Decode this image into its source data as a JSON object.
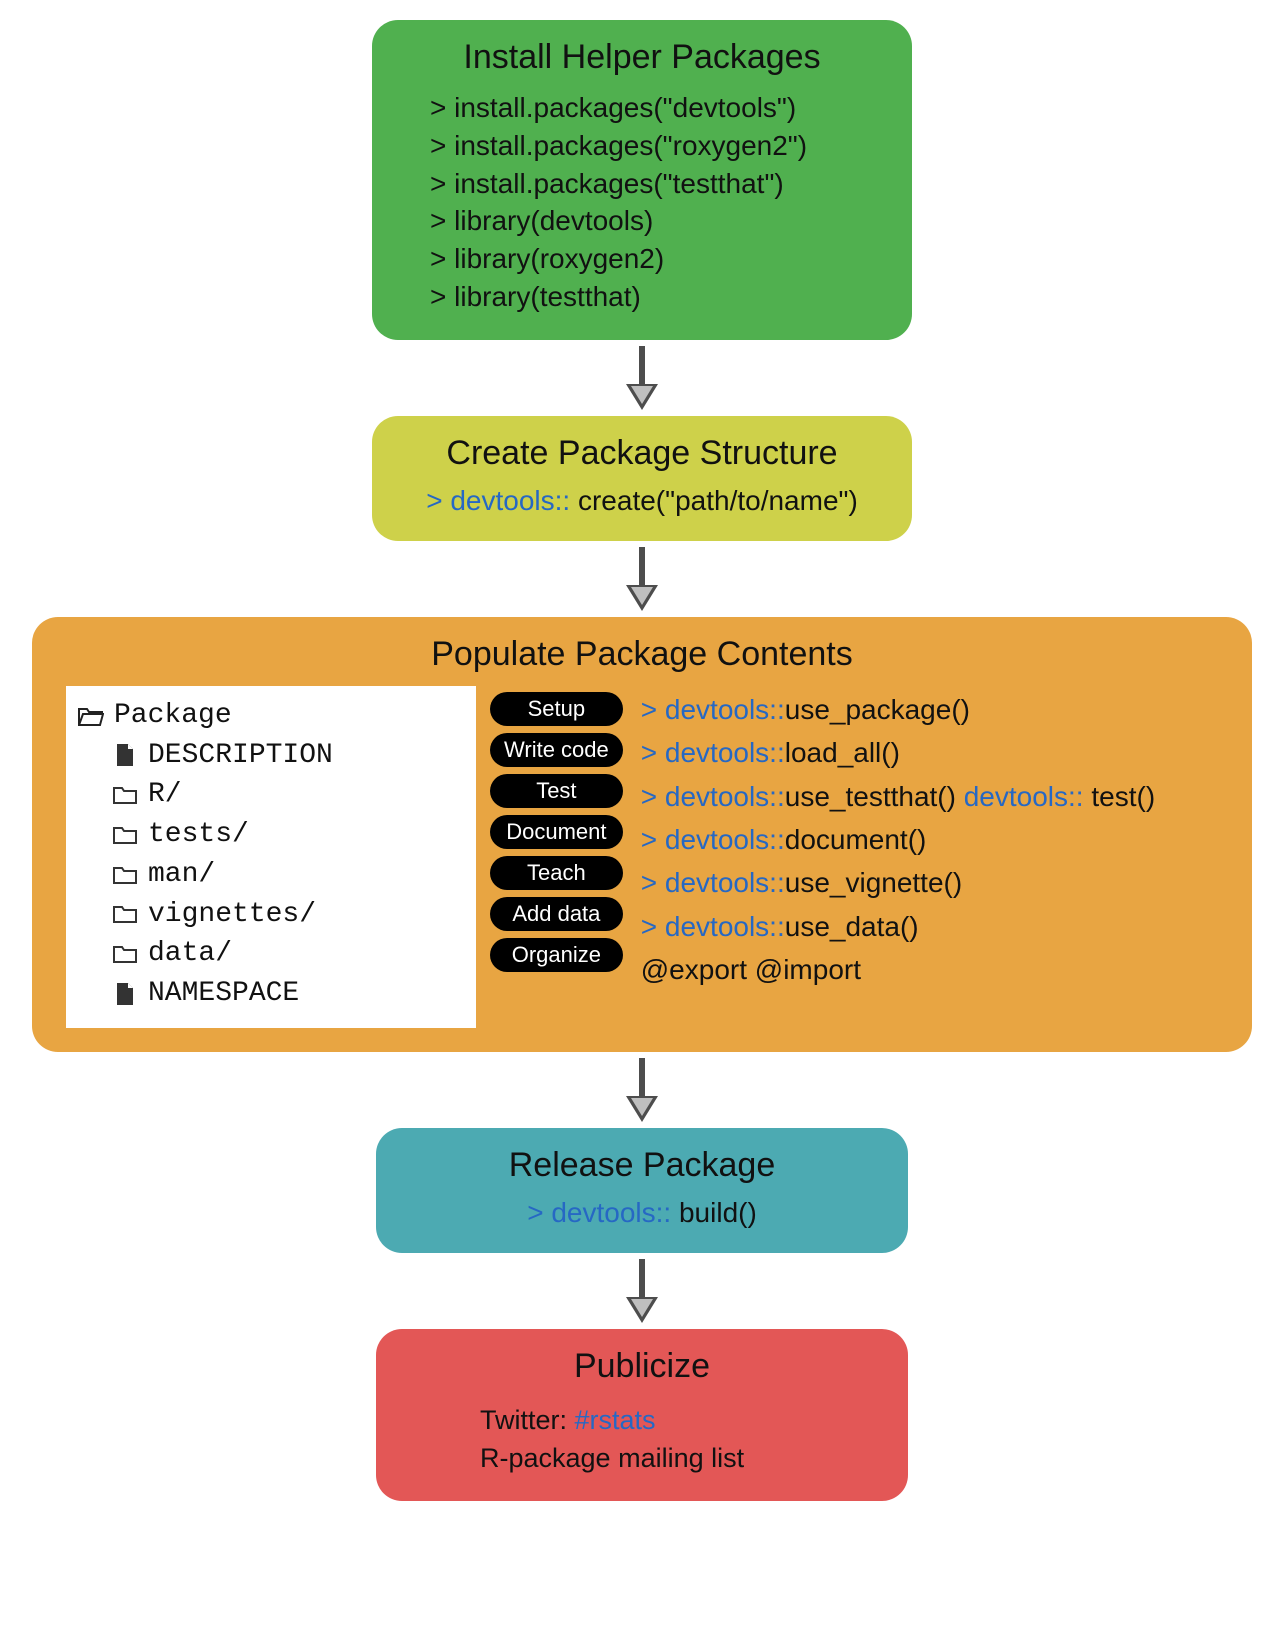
{
  "step1": {
    "title": "Install Helper Packages",
    "lines": [
      "> install.packages(\"devtools\")",
      "> install.packages(\"roxygen2\")",
      "> install.packages(\"testthat\")",
      "> library(devtools)",
      "> library(roxygen2)",
      "> library(testthat)"
    ]
  },
  "step2": {
    "title": "Create Package Structure",
    "prompt": "> ",
    "ns": "devtools:: ",
    "call": "create(\"path/to/name\")"
  },
  "step3": {
    "title": "Populate Package Contents",
    "files": {
      "root": "Package",
      "items": [
        {
          "icon": "file",
          "name": "DESCRIPTION"
        },
        {
          "icon": "folder",
          "name": "R/"
        },
        {
          "icon": "folder",
          "name": "tests/"
        },
        {
          "icon": "folder",
          "name": "man/"
        },
        {
          "icon": "folder",
          "name": "vignettes/"
        },
        {
          "icon": "folder",
          "name": "data/"
        },
        {
          "icon": "file",
          "name": "NAMESPACE"
        }
      ]
    },
    "pills": [
      "Setup",
      "Write code",
      "Test",
      "Document",
      "Teach",
      "Add data",
      "Organize"
    ],
    "cmds": [
      {
        "prompt": "> ",
        "ns": "devtools::",
        "calls": [
          "use_package()"
        ]
      },
      {
        "prompt": "> ",
        "ns": "devtools::",
        "calls": [
          "load_all()"
        ]
      },
      {
        "prompt": "> ",
        "ns": "devtools::",
        "calls": [
          "use_testthat()"
        ],
        "extra_ns": "devtools:: ",
        "extra_call": "test()"
      },
      {
        "prompt": "> ",
        "ns": "devtools::",
        "calls": [
          "document()"
        ]
      },
      {
        "prompt": "> ",
        "ns": "devtools::",
        "calls": [
          "use_vignette()"
        ]
      },
      {
        "prompt": "> ",
        "ns": "devtools::",
        "calls": [
          "use_data()"
        ]
      },
      {
        "plain": "@export  @import"
      }
    ]
  },
  "step4": {
    "title": "Release Package",
    "prompt": "> ",
    "ns": "devtools:: ",
    "call": "build()"
  },
  "step5": {
    "title": "Publicize",
    "line1_label": "Twitter: ",
    "line1_tag": "#rstats",
    "line2": "R-package mailing list"
  }
}
